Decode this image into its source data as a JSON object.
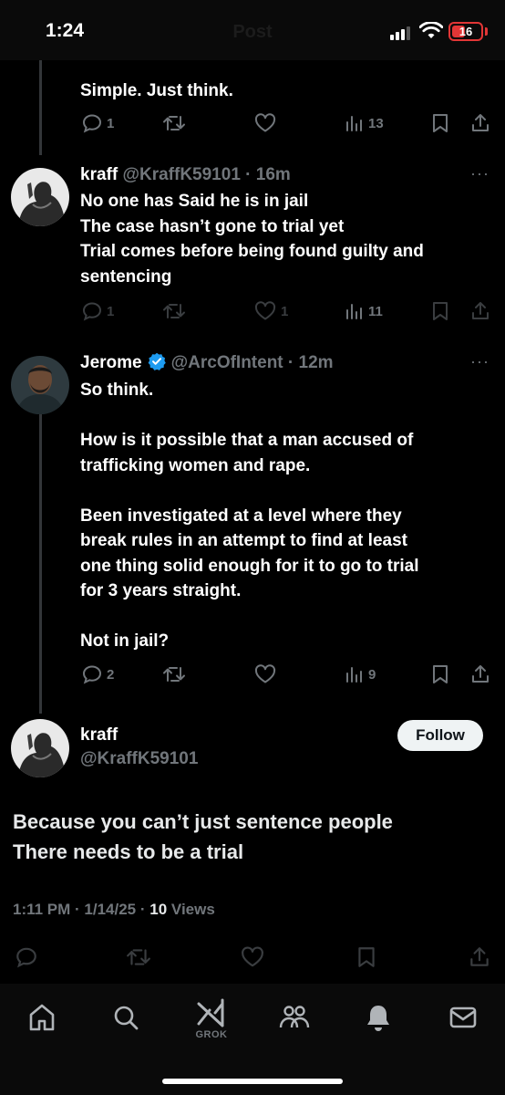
{
  "status_bar": {
    "time": "1:24",
    "battery": "16",
    "faded_title": "Post"
  },
  "replies": [
    {
      "text": "Simple. Just think.",
      "actions": {
        "replies": "1",
        "reposts": "",
        "likes": "",
        "views": "13"
      }
    },
    {
      "name": "kraff",
      "handle": "@KraffK59101",
      "time": "16m",
      "text": "No one has Said he is in jail\nThe case hasn’t gone to trial yet\nTrial comes before being found guilty and\nsentencing",
      "actions": {
        "replies": "1",
        "reposts": "",
        "likes": "1",
        "views": "11"
      }
    },
    {
      "name": "Jerome",
      "handle": "@ArcOfIntent",
      "time": "12m",
      "text": "So think.\n\nHow is it possible that a man accused of\ntrafficking women and rape.\n\nBeen investigated at a level where they\nbreak rules in an attempt to find at least\none thing solid enough for it to go to trial\nfor 3 years straight.\n\nNot in jail?",
      "actions": {
        "replies": "2",
        "reposts": "",
        "likes": "",
        "views": "9"
      }
    }
  ],
  "main_post": {
    "name": "kraff",
    "handle": "@KraffK59101",
    "follow_label": "Follow",
    "text": "Because you can’t just sentence people\nThere needs to be a trial",
    "time": "1:11 PM",
    "date": "1/14/25",
    "views_count": "10",
    "views_label": "Views"
  },
  "nav": {
    "items": [
      "home",
      "search",
      "grok",
      "communities",
      "notifications",
      "messages"
    ],
    "grok_label": "GROK"
  },
  "colors": {
    "background": "#000000",
    "text": "#e7e9ea",
    "muted": "#71767b",
    "verified": "#1d9bf0",
    "battery": "#e23636"
  }
}
